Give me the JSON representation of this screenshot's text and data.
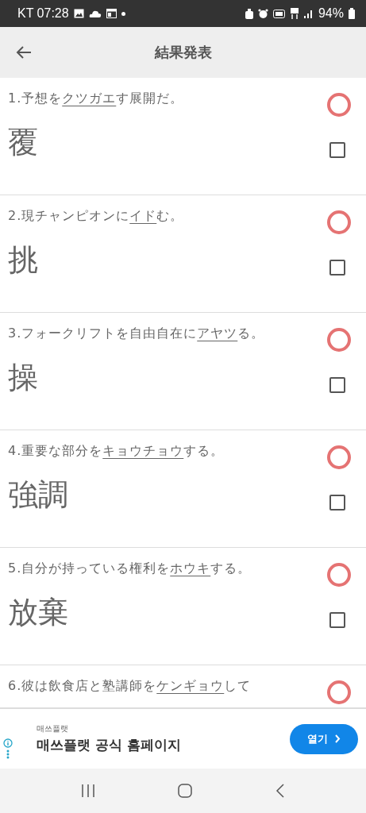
{
  "status_bar": {
    "time": "KT 07:28",
    "battery": "94%"
  },
  "header": {
    "title": "結果発表"
  },
  "questions": [
    {
      "number": "1.",
      "before": "予想を",
      "target": "クツガエ",
      "after": "す展開だ。",
      "correct": true,
      "answer": "覆",
      "checked": false
    },
    {
      "number": "2.",
      "before": "現チャンピオンに",
      "target": "イド",
      "after": "む。",
      "correct": true,
      "answer": "挑",
      "checked": false
    },
    {
      "number": "3.",
      "before": "フォークリフトを自由自在に",
      "target": "アヤツ",
      "after": "る。",
      "correct": true,
      "answer": "操",
      "checked": false
    },
    {
      "number": "4.",
      "before": "重要な部分を",
      "target": "キョウチョウ",
      "after": "する。",
      "correct": true,
      "answer": "強調",
      "checked": false
    },
    {
      "number": "5.",
      "before": "自分が持っている権利を",
      "target": "ホウキ",
      "after": "する。",
      "correct": true,
      "answer": "放棄",
      "checked": false
    },
    {
      "number": "6.",
      "before": "彼は飲食店と塾講師を",
      "target": "ケンギョウ",
      "after": "して",
      "correct": true
    }
  ],
  "ad": {
    "advertiser": "매쓰플랫",
    "headline": "매쓰플랫 공식 홈페이지",
    "button": "열기"
  }
}
